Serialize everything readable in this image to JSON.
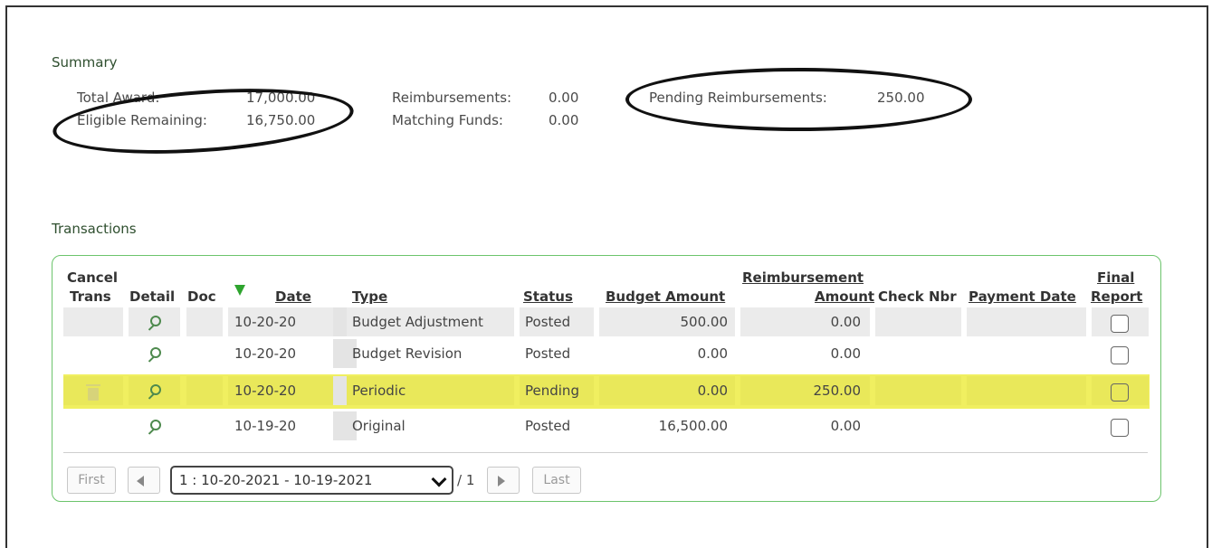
{
  "summary": {
    "title": "Summary",
    "total_award_label": "Total Award:",
    "total_award_value": "17,000.00",
    "eligible_remaining_label": "Eligible Remaining:",
    "eligible_remaining_value": "16,750.00",
    "reimbursements_label": "Reimbursements:",
    "reimbursements_value": "0.00",
    "matching_funds_label": "Matching Funds:",
    "matching_funds_value": "0.00",
    "pending_reimbursements_label": "Pending Reimbursements:",
    "pending_reimbursements_value": "250.00"
  },
  "transactions": {
    "title": "Transactions",
    "headers": {
      "cancel_line1": "Cancel",
      "cancel_line2": "Trans",
      "detail": "Detail",
      "doc": "Doc",
      "date": "Date",
      "type": "Type",
      "status": "Status",
      "budget_amount": "Budget Amount",
      "reimbursement_line1": "Reimbursement",
      "reimbursement_line2": "Amount",
      "check_nbr": "Check Nbr",
      "payment_date": "Payment Date",
      "final_line1": "Final",
      "final_line2": "Report"
    },
    "rows": [
      {
        "date": "10-20-20",
        "type": "Budget Adjustment",
        "status": "Posted",
        "budget_amount": "500.00",
        "reimbursement_amount": "0.00"
      },
      {
        "date": "10-20-20",
        "type": "Budget Revision",
        "status": "Posted",
        "budget_amount": "0.00",
        "reimbursement_amount": "0.00"
      },
      {
        "date": "10-20-20",
        "type": "Periodic",
        "status": "Pending",
        "budget_amount": "0.00",
        "reimbursement_amount": "250.00"
      },
      {
        "date": "10-19-20",
        "type": "Original",
        "status": "Posted",
        "budget_amount": "16,500.00",
        "reimbursement_amount": "0.00"
      }
    ]
  },
  "pagination": {
    "first_label": "First",
    "last_label": "Last",
    "selected_page": "1 : 10-20-2021 - 10-19-2021",
    "total_pages": "/ 1"
  },
  "colors": {
    "highlight": "#f0ef60",
    "grid_border": "#6cc46c",
    "sort_arrow": "#2ea42e"
  },
  "icons": {
    "detail": "magnifier-icon",
    "cancel": "trash-icon",
    "sort": "sort-desc-icon"
  }
}
